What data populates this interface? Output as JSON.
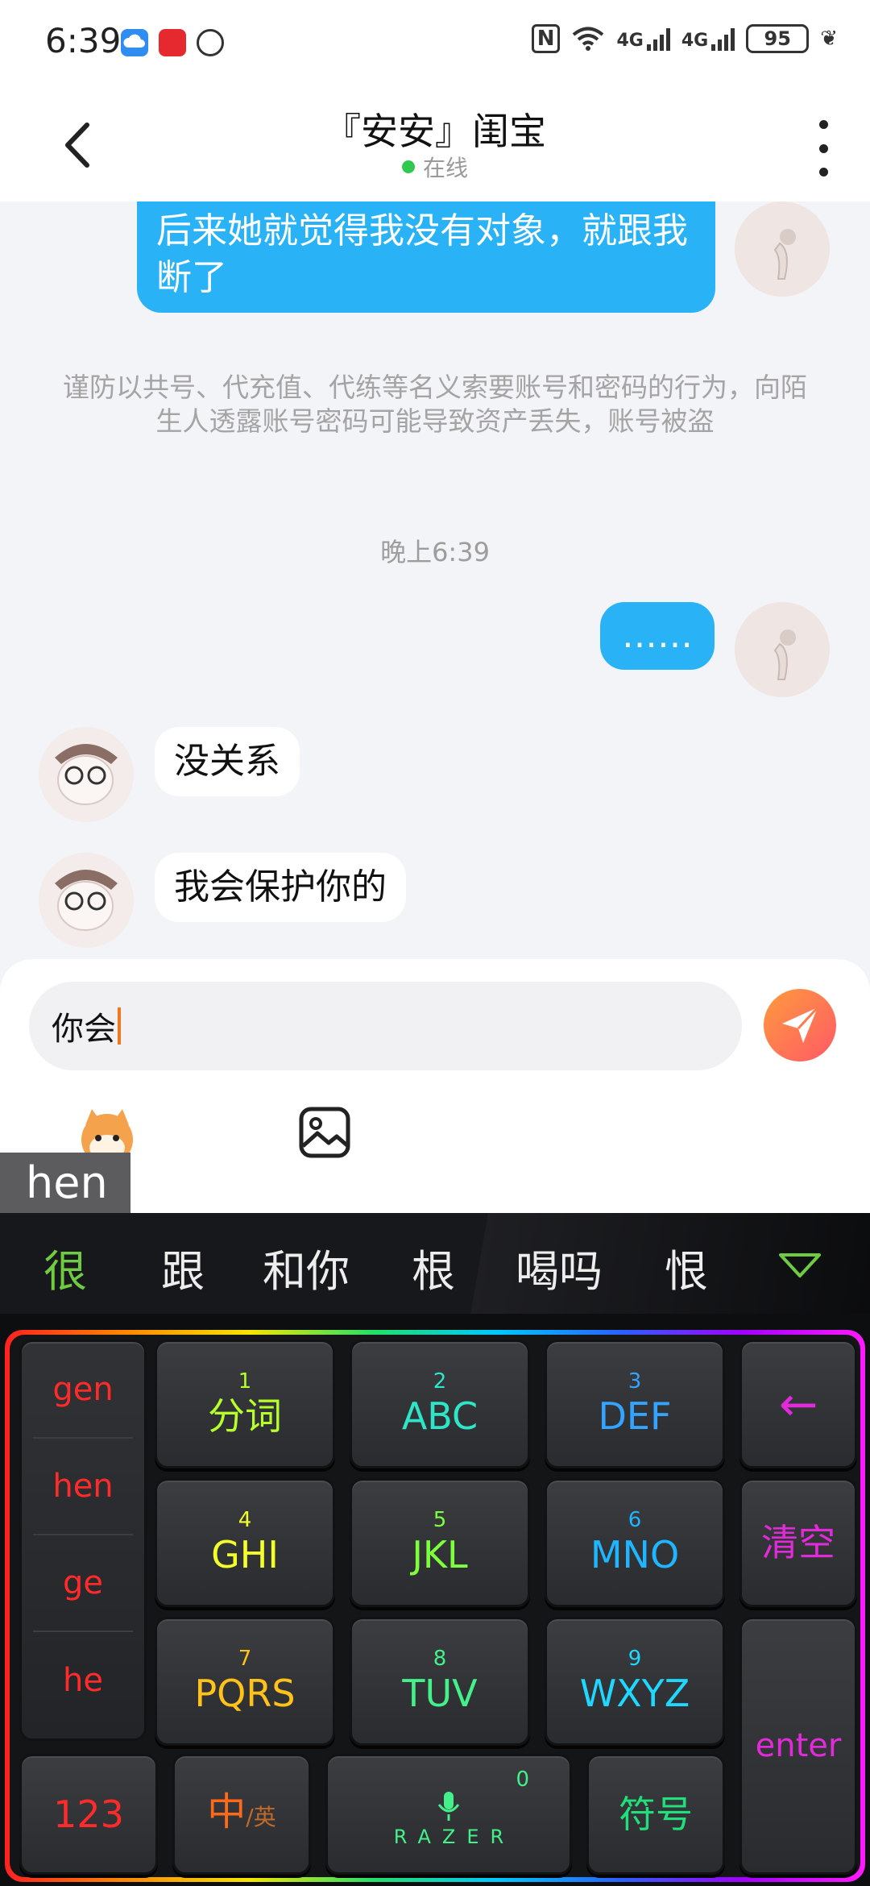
{
  "status_bar": {
    "time": "6:39",
    "network_1": "4G",
    "network_2": "4G",
    "battery": "95",
    "icons": [
      "cloud-icon",
      "taobao-618-icon",
      "data-saver-icon",
      "nfc-icon",
      "wifi-icon",
      "signal-icon",
      "battery-icon",
      "leaf-icon"
    ]
  },
  "header": {
    "title": "『安安』闺宝",
    "status": "在线",
    "status_color": "#2ec94e"
  },
  "chat": {
    "messages": [
      {
        "side": "me",
        "text": "后来她就觉得我没有对象，就跟我断了"
      },
      {
        "side": "me",
        "text": "……"
      },
      {
        "side": "them",
        "text": "没关系"
      },
      {
        "side": "them",
        "text": "我会保护你的"
      }
    ],
    "notice": "谨防以共号、代充值、代练等名义索要账号和密码的行为，向陌生人透露账号密码可能导致资产丢失，账号被盗",
    "timestamp": "晚上6:39",
    "bubble_color": "#29b3f6"
  },
  "input": {
    "value": "你会",
    "pinyin_preview": "hen"
  },
  "keyboard": {
    "candidates": [
      "很",
      "跟",
      "和你",
      "根",
      "喝吗",
      "恨"
    ],
    "pinyin_options": [
      "gen",
      "hen",
      "ge",
      "he"
    ],
    "keys": [
      {
        "num": "1",
        "label": "分词",
        "color": "#b6ff2a"
      },
      {
        "num": "2",
        "label": "ABC",
        "color": "#2ee6c7"
      },
      {
        "num": "3",
        "label": "DEF",
        "color": "#33a4ff"
      },
      {
        "num": "4",
        "label": "GHI",
        "color": "#f4ff2a"
      },
      {
        "num": "5",
        "label": "JKL",
        "color": "#7dff3d"
      },
      {
        "num": "6",
        "label": "MNO",
        "color": "#1fb6ff"
      },
      {
        "num": "7",
        "label": "PQRS",
        "color": "#ffc21a"
      },
      {
        "num": "8",
        "label": "TUV",
        "color": "#43f08a"
      },
      {
        "num": "9",
        "label": "WXYZ",
        "color": "#1fd7ff"
      }
    ],
    "backspace": "←",
    "clear": "清空",
    "enter": "enter",
    "num_mode": "123",
    "lang_main": "中",
    "lang_sub": "/英",
    "space_num": "0",
    "space_brand": "RAZER",
    "symbols": "符号"
  }
}
